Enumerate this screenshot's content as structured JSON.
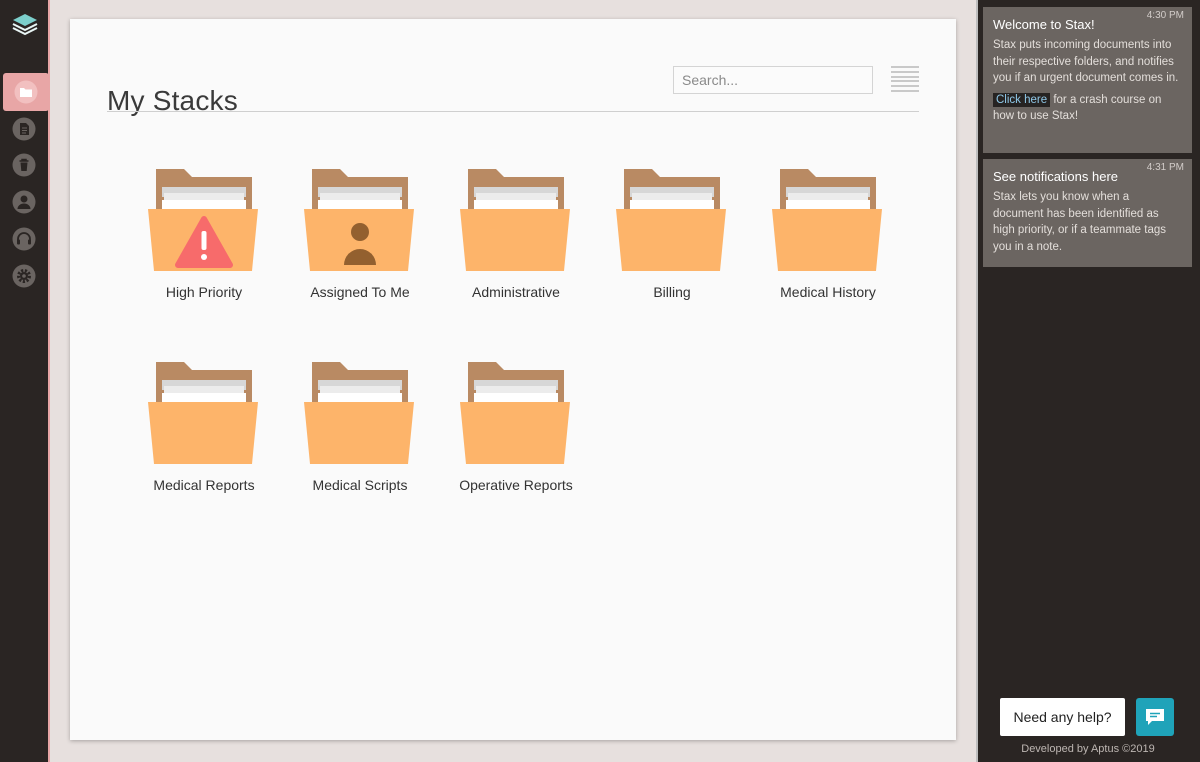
{
  "app": {
    "logo_icon": "layers-icon",
    "accent_color": "#e8a6a6",
    "folder_color": "#fdb46a"
  },
  "nav": [
    {
      "icon": "folder-icon",
      "active": true
    },
    {
      "icon": "document-icon",
      "active": false
    },
    {
      "icon": "trash-icon",
      "active": false
    },
    {
      "icon": "user-icon",
      "active": false
    },
    {
      "icon": "headset-icon",
      "active": false
    },
    {
      "icon": "gear-icon",
      "active": false
    }
  ],
  "main": {
    "title": "My Stacks",
    "search_placeholder": "Search..."
  },
  "folders": [
    {
      "label": "High Priority",
      "badge": "warning-icon"
    },
    {
      "label": "Assigned To Me",
      "badge": "user-icon"
    },
    {
      "label": "Administrative",
      "badge": ""
    },
    {
      "label": "Billing",
      "badge": ""
    },
    {
      "label": "Medical History",
      "badge": ""
    },
    {
      "label": "Medical Reports",
      "badge": ""
    },
    {
      "label": "Medical Scripts",
      "badge": ""
    },
    {
      "label": "Operative Reports",
      "badge": ""
    }
  ],
  "notifications": [
    {
      "time": "4:30 PM",
      "title": "Welcome to Stax!",
      "body": "Stax puts incoming documents into their respective folders, and notifies you if an urgent document comes in.",
      "link_text": "Click here",
      "link_suffix": " for a crash course on how to use Stax!"
    },
    {
      "time": "4:31 PM",
      "title": "See notifications here",
      "body": "Stax lets you know when a document has been identified as high priority, or if a teammate tags you in a note."
    }
  ],
  "help": {
    "label": "Need any help?",
    "chat_icon": "chat-icon",
    "chat_color": "#1fa3b9"
  },
  "footer": "Developed by Aptus ©2019"
}
